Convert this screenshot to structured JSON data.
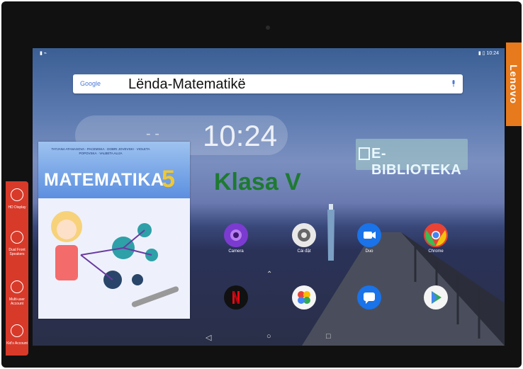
{
  "device": {
    "brand_label": "Lenovo"
  },
  "statusbar": {
    "left_icons": "▮ ⌁",
    "time": "10:24",
    "right_icons": "▮ ▯ 10:24"
  },
  "search": {
    "engine_label": "Google",
    "query": "Lënda-Matematikë"
  },
  "home": {
    "clock": "10:24",
    "weather_placeholder": "- -",
    "apps_row1": [
      {
        "label": "Camera",
        "icon": "camera-icon",
        "color": "#7b3bd0"
      },
      {
        "label": "Cài đặt",
        "icon": "settings-icon",
        "color": "#e8e8e8"
      },
      {
        "label": "Duo",
        "icon": "video-icon",
        "color": "#1a73e8"
      },
      {
        "label": "Chrome",
        "icon": "chrome-icon",
        "color": "#e84335"
      }
    ],
    "apps_row2": [
      {
        "label": "",
        "icon": "netflix-icon",
        "color": "#111111"
      },
      {
        "label": "",
        "icon": "photos-icon",
        "color": "#f5f5f5"
      },
      {
        "label": "",
        "icon": "messages-icon",
        "color": "#1a73e8"
      },
      {
        "label": "",
        "icon": "play-store-icon",
        "color": "#f5f5f5"
      }
    ],
    "nav": {
      "back": "◁",
      "home": "○",
      "recents": "□"
    }
  },
  "overlay": {
    "ebiblioteka": "E-BIBLIOTEKA",
    "klasa": "Klasa V"
  },
  "book": {
    "authors": "TATJANA ATANASOVA - PACEMSKA · DOBRI JOVEVSKI · VIOLETA POPOVSKA · VALBETA ALIJA",
    "title": "MATEMATIKA",
    "grade": "5"
  },
  "left_panel": [
    {
      "label": "HD Display",
      "icon": "display-icon"
    },
    {
      "label": "Dual Front Speakers",
      "icon": "speaker-icon"
    },
    {
      "label": "Multi-user Account",
      "icon": "users-icon"
    },
    {
      "label": "Kid's Account",
      "icon": "kid-icon"
    }
  ],
  "colors": {
    "accent_orange": "#e77a1c",
    "panel_red": "#d83a2a",
    "klasa_green": "#1e7a31"
  }
}
